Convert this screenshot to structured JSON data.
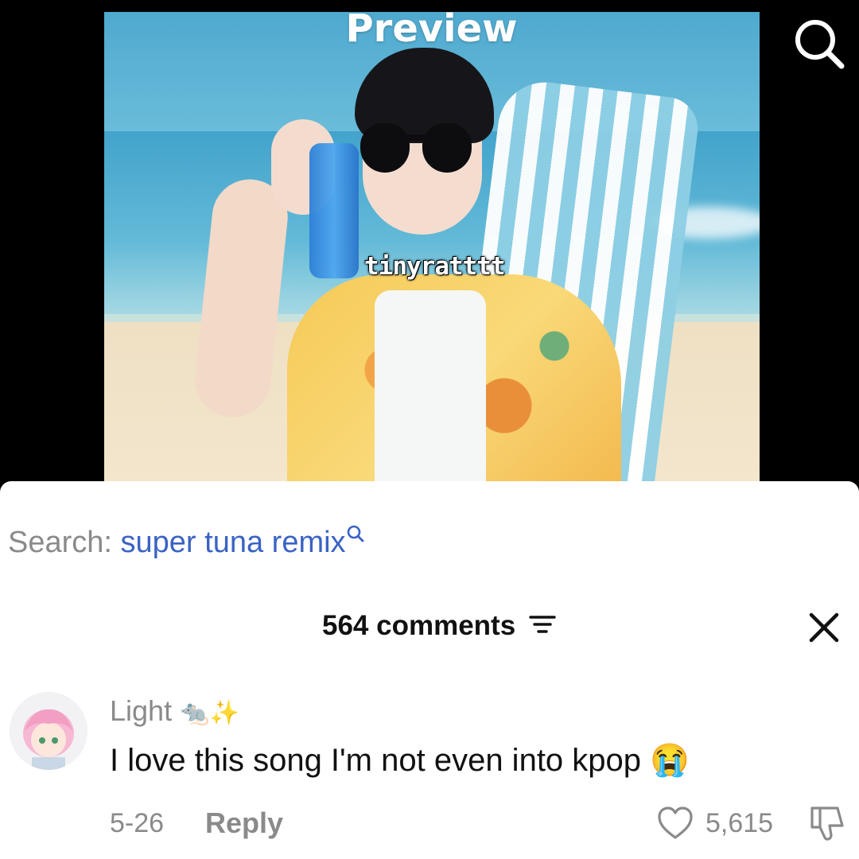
{
  "preview": {
    "title": "Preview",
    "watermark": "tinyratttt"
  },
  "search": {
    "label": "Search:",
    "query": "super tuna remix"
  },
  "comments": {
    "count_label": "564 comments"
  },
  "comment": {
    "user_name": "Light",
    "name_emojis": "🐀✨",
    "text": "I love this song I'm not even into kpop",
    "text_emoji": "😭",
    "date": "5-26",
    "reply_label": "Reply",
    "like_count": "5,615"
  },
  "icons": {
    "search": "search-icon",
    "filter": "filter-icon",
    "close": "close-icon",
    "heart": "heart-icon",
    "dislike": "thumbs-down-icon"
  },
  "colors": {
    "query_link": "#3b63c4",
    "muted_text": "#8a8a8a",
    "primary_text": "#111111",
    "background_top": "#000000",
    "sheet": "#ffffff"
  }
}
